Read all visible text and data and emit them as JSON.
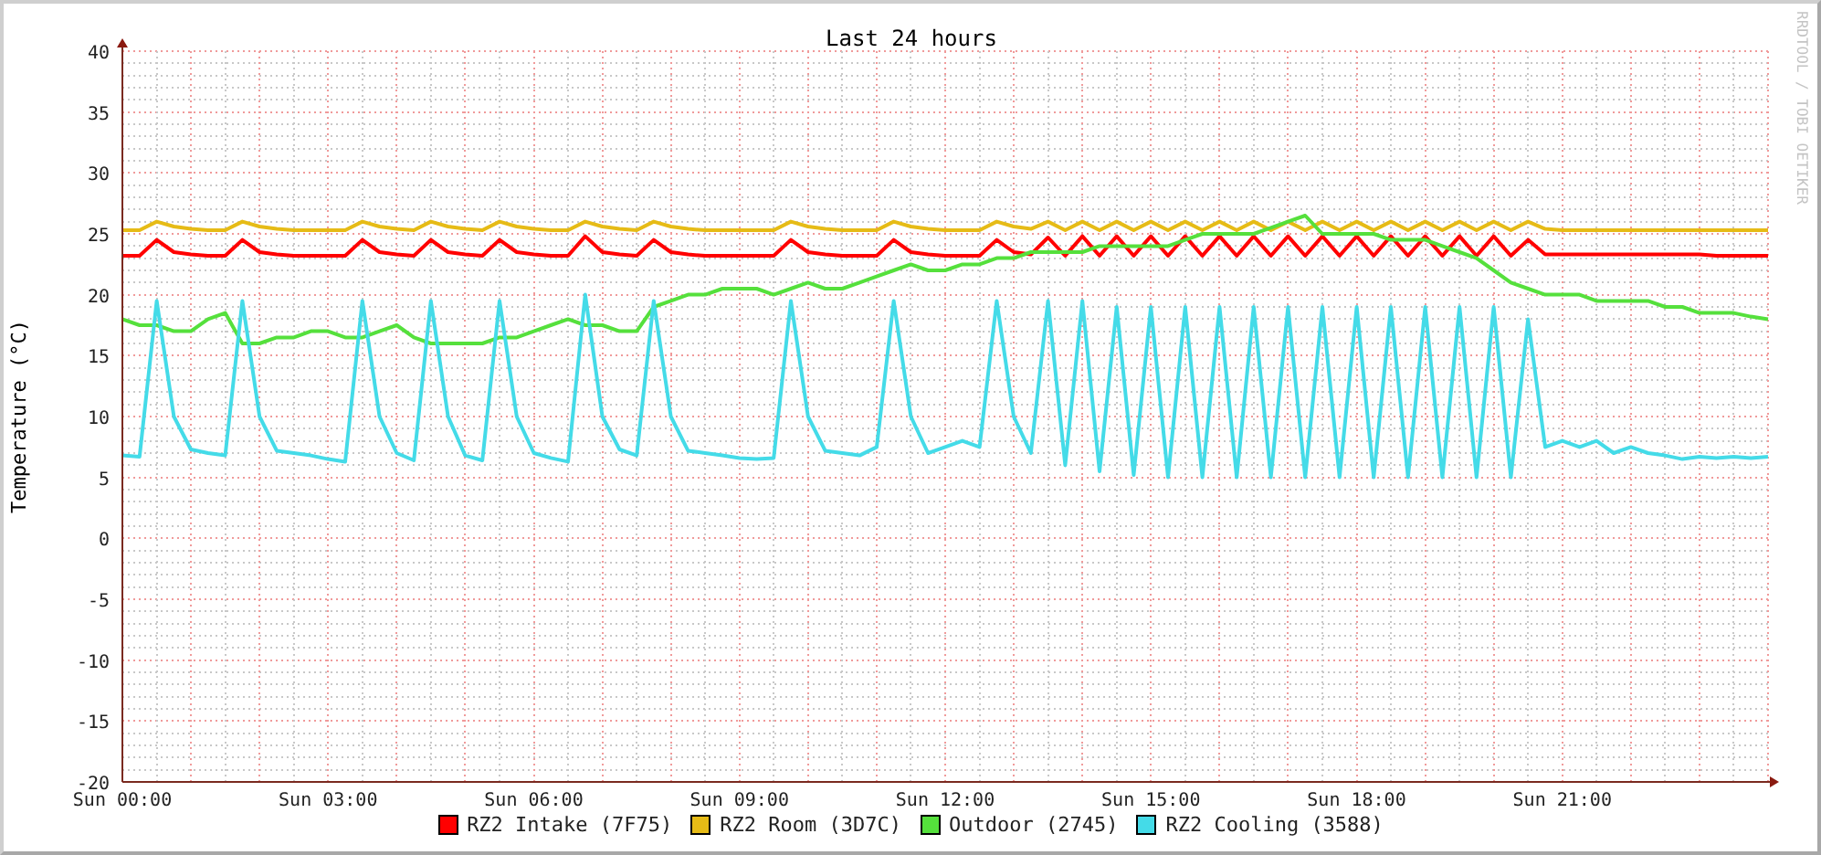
{
  "graph": {
    "credit": "RRDTOOL / TOBI OETIKER",
    "chart_data": {
      "type": "line",
      "title": "Last 24 hours",
      "ylabel": "Temperature (°C)",
      "categories": [
        "Sun 00:00",
        null,
        null,
        null,
        null,
        null,
        null,
        null,
        null,
        null,
        null,
        null,
        "Sun 03:00",
        null,
        null,
        null,
        null,
        null,
        null,
        null,
        null,
        null,
        null,
        null,
        "Sun 06:00",
        null,
        null,
        null,
        null,
        null,
        null,
        null,
        null,
        null,
        null,
        null,
        "Sun 09:00",
        null,
        null,
        null,
        null,
        null,
        null,
        null,
        null,
        null,
        null,
        null,
        "Sun 12:00",
        null,
        null,
        null,
        null,
        null,
        null,
        null,
        null,
        null,
        null,
        null,
        "Sun 15:00",
        null,
        null,
        null,
        null,
        null,
        null,
        null,
        null,
        null,
        null,
        null,
        "Sun 18:00",
        null,
        null,
        null,
        null,
        null,
        null,
        null,
        null,
        null,
        null,
        null,
        "Sun 21:00",
        null,
        null,
        null,
        null,
        null,
        null,
        null,
        null,
        null,
        null,
        null,
        null
      ],
      "ylim": [
        -20,
        40
      ],
      "grid": true,
      "yticks": [
        40,
        35,
        30,
        25,
        20,
        15,
        10,
        5,
        0,
        -5,
        -10,
        -15,
        -20
      ],
      "series": [
        {
          "name": "RZ2 Intake (7F75)",
          "color": "#ff0000",
          "values": [
            23.2,
            23.2,
            24.5,
            23.5,
            23.3,
            23.2,
            23.2,
            24.5,
            23.5,
            23.3,
            23.2,
            23.2,
            23.2,
            23.2,
            24.5,
            23.5,
            23.3,
            23.2,
            24.5,
            23.5,
            23.3,
            23.2,
            24.5,
            23.5,
            23.3,
            23.2,
            23.2,
            24.8,
            23.5,
            23.3,
            23.2,
            24.5,
            23.5,
            23.3,
            23.2,
            23.2,
            23.2,
            23.2,
            23.2,
            24.5,
            23.5,
            23.3,
            23.2,
            23.2,
            23.2,
            24.5,
            23.5,
            23.3,
            23.2,
            23.2,
            23.2,
            24.5,
            23.5,
            23.3,
            24.7,
            23.2,
            24.8,
            23.2,
            24.8,
            23.2,
            24.8,
            23.2,
            24.8,
            23.2,
            24.8,
            23.2,
            24.8,
            23.2,
            24.8,
            23.2,
            24.8,
            23.2,
            24.8,
            23.2,
            24.8,
            23.2,
            24.8,
            23.2,
            24.8,
            23.2,
            24.8,
            23.2,
            24.5,
            23.3,
            23.3,
            23.3,
            23.3,
            23.3,
            23.3,
            23.3,
            23.3,
            23.3,
            23.3,
            23.2,
            23.2,
            23.2,
            23.2
          ]
        },
        {
          "name": "RZ2 Room (3D7C)",
          "color": "#e6bb16",
          "values": [
            25.3,
            25.3,
            26.0,
            25.6,
            25.4,
            25.3,
            25.3,
            26.0,
            25.6,
            25.4,
            25.3,
            25.3,
            25.3,
            25.3,
            26.0,
            25.6,
            25.4,
            25.3,
            26.0,
            25.6,
            25.4,
            25.3,
            26.0,
            25.6,
            25.4,
            25.3,
            25.3,
            26.0,
            25.6,
            25.4,
            25.3,
            26.0,
            25.6,
            25.4,
            25.3,
            25.3,
            25.3,
            25.3,
            25.3,
            26.0,
            25.6,
            25.4,
            25.3,
            25.3,
            25.3,
            26.0,
            25.6,
            25.4,
            25.3,
            25.3,
            25.3,
            26.0,
            25.6,
            25.4,
            26.0,
            25.3,
            26.0,
            25.3,
            26.0,
            25.3,
            26.0,
            25.3,
            26.0,
            25.3,
            26.0,
            25.3,
            26.0,
            25.3,
            26.0,
            25.3,
            26.0,
            25.3,
            26.0,
            25.3,
            26.0,
            25.3,
            26.0,
            25.3,
            26.0,
            25.3,
            26.0,
            25.3,
            26.0,
            25.4,
            25.3,
            25.3,
            25.3,
            25.3,
            25.3,
            25.3,
            25.3,
            25.3,
            25.3,
            25.3,
            25.3,
            25.3,
            25.3
          ]
        },
        {
          "name": "Outdoor (2745)",
          "color": "#55e03c",
          "values": [
            18,
            17.5,
            17.5,
            17,
            17,
            18,
            18.5,
            16,
            16,
            16.5,
            16.5,
            17,
            17,
            16.5,
            16.5,
            17,
            17.5,
            16.5,
            16,
            16,
            16,
            16,
            16.5,
            16.5,
            17,
            17.5,
            18,
            17.5,
            17.5,
            17,
            17,
            19,
            19.5,
            20,
            20,
            20.5,
            20.5,
            20.5,
            20,
            20.5,
            21,
            20.5,
            20.5,
            21,
            21.5,
            22,
            22.5,
            22,
            22,
            22.5,
            22.5,
            23,
            23,
            23.5,
            23.5,
            23.5,
            23.5,
            24,
            24,
            24,
            24,
            24,
            24.5,
            25,
            25,
            25,
            25,
            25.5,
            26,
            26.5,
            25,
            25,
            25,
            25,
            24.5,
            24.5,
            24.5,
            24,
            23.5,
            23,
            22,
            21,
            20.5,
            20,
            20,
            20,
            19.5,
            19.5,
            19.5,
            19.5,
            19,
            19,
            18.5,
            18.5,
            18.5,
            18.2,
            18
          ]
        },
        {
          "name": "RZ2 Cooling (3588)",
          "color": "#44dbe8",
          "values": [
            6.8,
            6.7,
            19.5,
            10,
            7.3,
            7.0,
            6.8,
            19.5,
            10,
            7.2,
            7.0,
            6.8,
            6.5,
            6.3,
            19.5,
            10,
            7.0,
            6.4,
            19.5,
            10,
            6.8,
            6.4,
            19.5,
            10,
            7.0,
            6.6,
            6.3,
            20,
            10,
            7.3,
            6.8,
            19.5,
            10,
            7.2,
            7.0,
            6.8,
            6.6,
            6.5,
            6.6,
            19.5,
            10,
            7.2,
            7.0,
            6.8,
            7.5,
            19.5,
            10,
            7.0,
            7.5,
            8.0,
            7.5,
            19.5,
            10,
            7.0,
            19.5,
            6.0,
            19.5,
            5.5,
            19,
            5.2,
            19,
            5.0,
            19,
            5.0,
            19,
            5.0,
            19,
            5.0,
            19,
            5.0,
            19,
            5.0,
            19,
            5.0,
            19,
            5.0,
            19,
            5.0,
            19,
            5.0,
            19,
            5.0,
            18,
            7.5,
            8.0,
            7.5,
            8.0,
            7.0,
            7.5,
            7.0,
            6.8,
            6.5,
            6.7,
            6.6,
            6.7,
            6.6,
            6.7
          ]
        }
      ]
    }
  }
}
